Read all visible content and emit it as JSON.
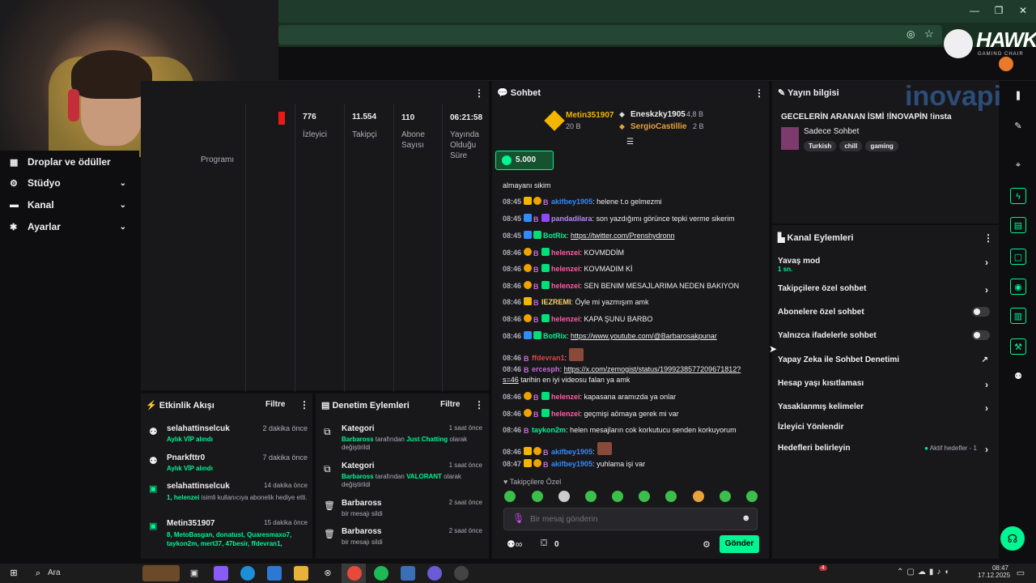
{
  "nav": {
    "items": [
      {
        "label": "Droplar ve ödüller",
        "icon": "gift-icon"
      },
      {
        "label": "Stüdyo",
        "icon": "studio-icon"
      },
      {
        "label": "Kanal",
        "icon": "channel-icon"
      },
      {
        "label": "Ayarlar",
        "icon": "gear-icon"
      }
    ]
  },
  "stats": {
    "program_label": "Programı",
    "items": [
      {
        "value": "776",
        "label": "İzleyici"
      },
      {
        "value": "11.554",
        "label": "Takipçi"
      },
      {
        "value": "110",
        "label": "Abone Sayısı"
      },
      {
        "value": "06:21:58",
        "label": "Yayında Olduğu Süre"
      }
    ]
  },
  "activity": {
    "title": "Etkinlik Akışı",
    "filter": "Filtre",
    "items": [
      {
        "name": "selahattinselcuk",
        "time": "2 dakika önce",
        "desc": "Aylık VİP alındı"
      },
      {
        "name": "Pnarkfttr0",
        "time": "7 dakika önce",
        "desc": "Aylık VİP alındı"
      },
      {
        "name": "selahattinselcuk",
        "time": "14 dakika önce",
        "desc_a": "1, helenzei",
        "desc_b": " isimli kullanıcıya abonelik hediye etti."
      },
      {
        "name": "Metin351907",
        "time": "15 dakika önce",
        "desc": "8, MetoBasgan, donatust, Quaresmaxo7, taykon2m, mert37, 47besir, ffdevran1,"
      }
    ]
  },
  "moderation": {
    "title": "Denetim Eylemleri",
    "filter": "Filtre",
    "items": [
      {
        "name": "Kategori",
        "time": "1 saat önce",
        "who": "Barbaross",
        "mid": " tarafından ",
        "cat": "Just Chatting",
        "end": " olarak değiştirildi"
      },
      {
        "name": "Kategori",
        "time": "1 saat önce",
        "who": "Barbaross",
        "mid": " tarafından ",
        "cat": "VALORANT",
        "end": " olarak değiştirildi"
      },
      {
        "name": "Barbaross",
        "time": "2 saat önce",
        "desc": "bir mesajı sildi"
      },
      {
        "name": "Barbaross",
        "time": "2 saat önce",
        "desc": "bir mesajı sildi"
      }
    ]
  },
  "chat": {
    "title": "Sohbet",
    "top1_name": "Metin351907",
    "top1_amt": "20 B",
    "top2_name": "Eneskzky1905",
    "top2_amt": "4,8 B",
    "top3_name": "SergioCastillie",
    "top3_amt": "2 B",
    "points": "5.000",
    "partial": "almayanı sikim",
    "lines": [
      {
        "t": "08:45",
        "u": "akifbey1905",
        "c": "#2f8bff",
        "m": ": helene t.o gelmezmi"
      },
      {
        "t": "08:45",
        "u": "pandadilara",
        "c": "#b488ff",
        "m": ": son yazdığımı görünce tepki verme sikerim"
      },
      {
        "t": "08:45",
        "u": "BotRix",
        "c": "#00f593",
        "m": ": ",
        "link": "https://twitter.com/Prenshydronn"
      },
      {
        "t": "08:46",
        "u": "helenzei",
        "c": "#ff5ea8",
        "m": ": KOVMDDİM"
      },
      {
        "t": "08:46",
        "u": "helenzei",
        "c": "#ff5ea8",
        "m": ": KOVMADIM Kİ"
      },
      {
        "t": "08:46",
        "u": "helenzei",
        "c": "#ff5ea8",
        "m": ": SEN BENIM MESAJLARIMA NEDEN BAKIYON"
      },
      {
        "t": "08:46",
        "u": "IEZREMI",
        "c": "#f6d36b",
        "m": ": Öyle mi yazmışım amk"
      },
      {
        "t": "08:46",
        "u": "helenzei",
        "c": "#ff5ea8",
        "m": ": KAPA ŞUNU BARBO"
      },
      {
        "t": "08:46",
        "u": "BotRix",
        "c": "#00f593",
        "m": ": ",
        "link": "https://www.youtube.com/@Barbarosakpunar"
      },
      {
        "t": "08:46",
        "u": "ffdevran1",
        "c": "#d44",
        "m": ":"
      },
      {
        "t": "08:46",
        "u": "ercesph",
        "c": "#c46bd4",
        "m": ": ",
        "link": "https://x.com/zemogist/status/1999238577209671812?s=46",
        "after": " tarihin en iyi videosu falan ya amk"
      },
      {
        "t": "08:46",
        "u": "helenzei",
        "c": "#ff5ea8",
        "m": ": kapasana aramızda ya onlar"
      },
      {
        "t": "08:46",
        "u": "helenzei",
        "c": "#ff5ea8",
        "m": ": geçmişi aömaya gerek mi var"
      },
      {
        "t": "08:46",
        "u": "taykon2m",
        "c": "#00f593",
        "m": ": helen mesajların cok korkutucu senden korkuyorum"
      },
      {
        "t": "08:46",
        "u": "akifbey1905",
        "c": "#2f8bff",
        "m": ":"
      },
      {
        "t": "08:47",
        "u": "akifbey1905",
        "c": "#2f8bff",
        "m": ": yuhlama işi var"
      }
    ],
    "followers_only": "Takipçilere Özel",
    "placeholder": "Bir mesaj gönderin",
    "count": "0",
    "send": "Gönder"
  },
  "info": {
    "title": "Yayın bilgisi",
    "stream_title": "GECELERİN ARANAN İSMİ !İNOVAPİN !insta",
    "category": "Sadece Sohbet",
    "tags": [
      "Turkish",
      "chill",
      "gaming"
    ]
  },
  "actions": {
    "title": "Kanal Eylemleri",
    "slow": "Yavaş mod",
    "slow_val": "1 sn.",
    "followers": "Takipçilere özel sohbet",
    "subs": "Abonelere özel sohbet",
    "emotes": "Yalnızca ifadelerle sohbet",
    "ai": "Yapay Zeka ile Sohbet Denetimi",
    "age": "Hesap yaşı kısıtlaması",
    "banned": "Yasaklanmış kelimeler",
    "viewer": "İzleyici Yönlendir",
    "goals": "Hedefleri belirleyin",
    "goals_status": "Aktif hedefler - 1"
  },
  "logos": {
    "hawk": "HAWK",
    "hawk_sub": "GAMING CHAIR",
    "inovapin": "inovapin"
  },
  "taskbar": {
    "search": "Ara",
    "time": "08:47",
    "date": "17.12.2025",
    "notif": "4"
  },
  "colors": {
    "accent": "#00f593",
    "panel": "#18181b",
    "bg": "#0e0e10"
  }
}
